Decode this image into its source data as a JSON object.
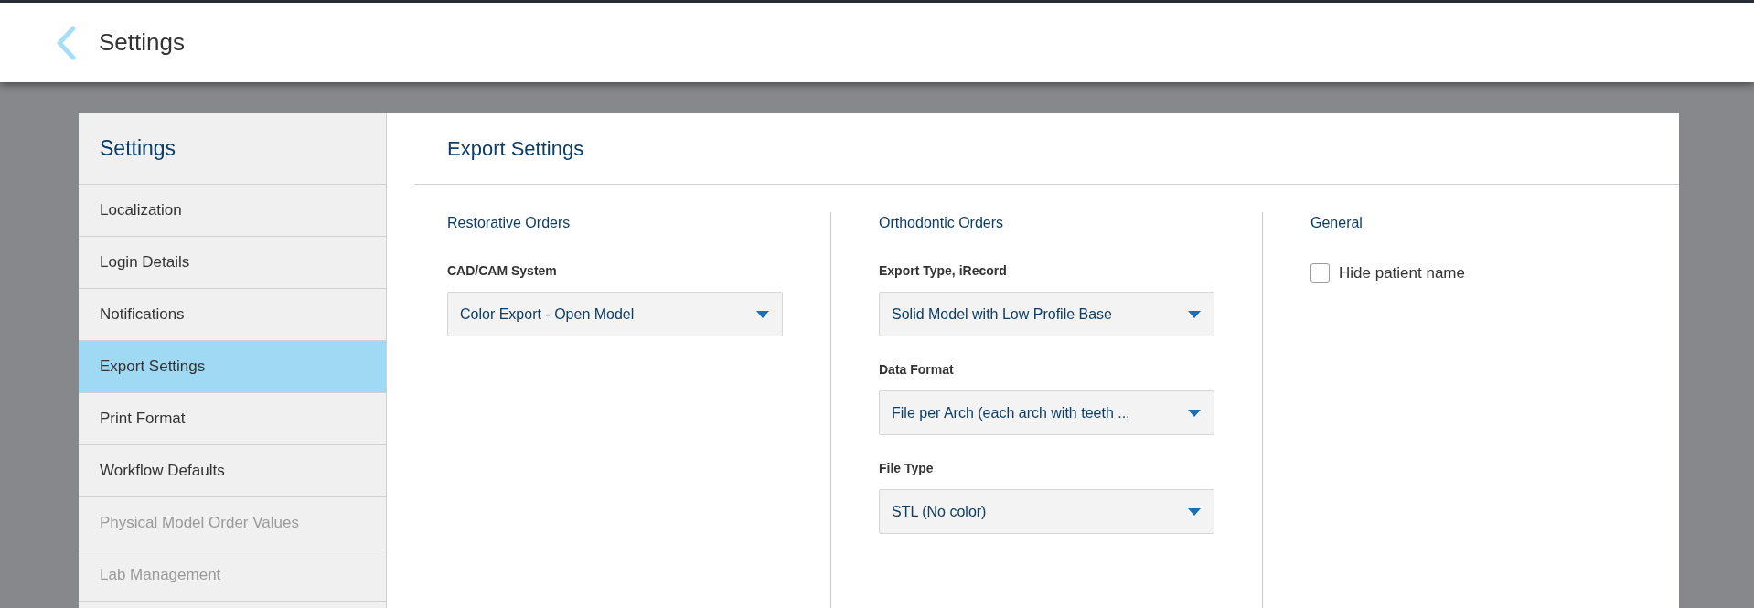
{
  "header": {
    "title": "Settings"
  },
  "sidebar": {
    "title": "Settings",
    "items": [
      {
        "label": "Localization",
        "selected": false,
        "disabled": false
      },
      {
        "label": "Login Details",
        "selected": false,
        "disabled": false
      },
      {
        "label": "Notifications",
        "selected": false,
        "disabled": false
      },
      {
        "label": "Export Settings",
        "selected": true,
        "disabled": false
      },
      {
        "label": "Print Format",
        "selected": false,
        "disabled": false
      },
      {
        "label": "Workflow Defaults",
        "selected": false,
        "disabled": false
      },
      {
        "label": "Physical Model Order Values",
        "selected": false,
        "disabled": true
      },
      {
        "label": "Lab Management",
        "selected": false,
        "disabled": true
      }
    ]
  },
  "content": {
    "title": "Export Settings",
    "sections": [
      {
        "title": "Restorative Orders",
        "fields": [
          {
            "kind": "select",
            "label": "CAD/CAM System",
            "value": "Color Export - Open Model"
          }
        ]
      },
      {
        "title": "Orthodontic Orders",
        "fields": [
          {
            "kind": "select",
            "label": "Export Type, iRecord",
            "value": "Solid Model with Low Profile Base"
          },
          {
            "kind": "select",
            "label": "Data Format",
            "value": "File per Arch (each arch with teeth ..."
          },
          {
            "kind": "select",
            "label": "File Type",
            "value": "STL (No color)"
          }
        ]
      },
      {
        "title": "General",
        "fields": [
          {
            "kind": "checkbox",
            "label": "Hide patient name",
            "checked": false
          }
        ]
      }
    ]
  }
}
